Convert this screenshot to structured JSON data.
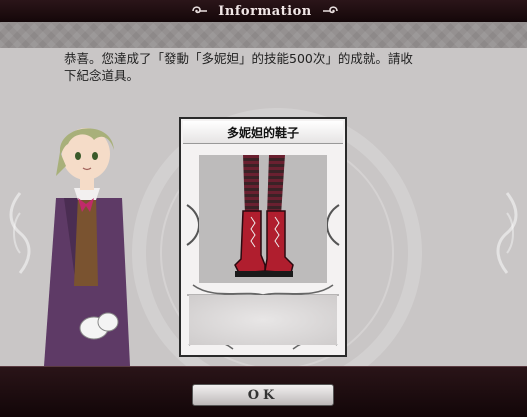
{
  "header": {
    "title": "Information"
  },
  "message": {
    "line1": "恭喜。您達成了「發動「多妮妲」的技能500次」的成就。請收",
    "line2": "下紀念道具。"
  },
  "card": {
    "title": "多妮妲的鞋子"
  },
  "footer": {
    "ok_label": "OK"
  },
  "colors": {
    "header_bg": "#1a0d10",
    "panel_bg": "#c9c6c6",
    "boot_red": "#b01e2e",
    "stocking_stripe": "#6a2030"
  }
}
